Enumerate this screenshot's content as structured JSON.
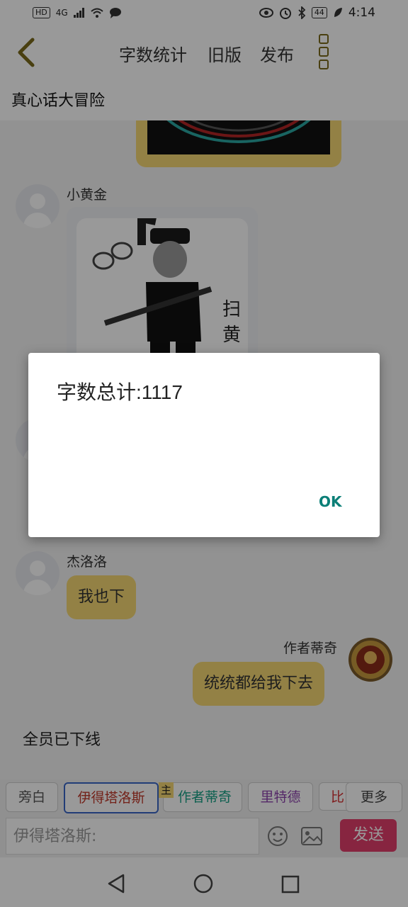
{
  "status_bar": {
    "left_icons": [
      "HD",
      "4G",
      "signal-icon",
      "wifi-icon",
      "message-icon"
    ],
    "battery": "44",
    "time": "4:14"
  },
  "nav": {
    "word_count_label": "字数统计",
    "old_version_label": "旧版",
    "publish_label": "发布"
  },
  "subtitle": "真心话大冒险",
  "messages": {
    "m1_name": "小黄金",
    "m1_img_text_1": "扫",
    "m1_img_text_2": "黄",
    "m2_name": "杰洛洛",
    "m2_text": "我也下",
    "m3_name": "作者蒂奇",
    "m3_text": "统统都给我下去",
    "system_text": "全员已下线"
  },
  "characters": {
    "c1": "旁白",
    "c2": "伊得塔洛斯",
    "c3": "作者蒂奇",
    "c3_badge": "主",
    "c4": "里特德",
    "c5": "比",
    "more": "更多"
  },
  "input": {
    "placeholder": "伊得塔洛斯:",
    "send_label": "发送"
  },
  "dialog": {
    "message": "字数总计:1117",
    "ok_label": "OK"
  },
  "colors": {
    "accent_yellow": "#f5d874",
    "send_pink": "#e23e6b",
    "dialog_button": "#0b7f77"
  }
}
